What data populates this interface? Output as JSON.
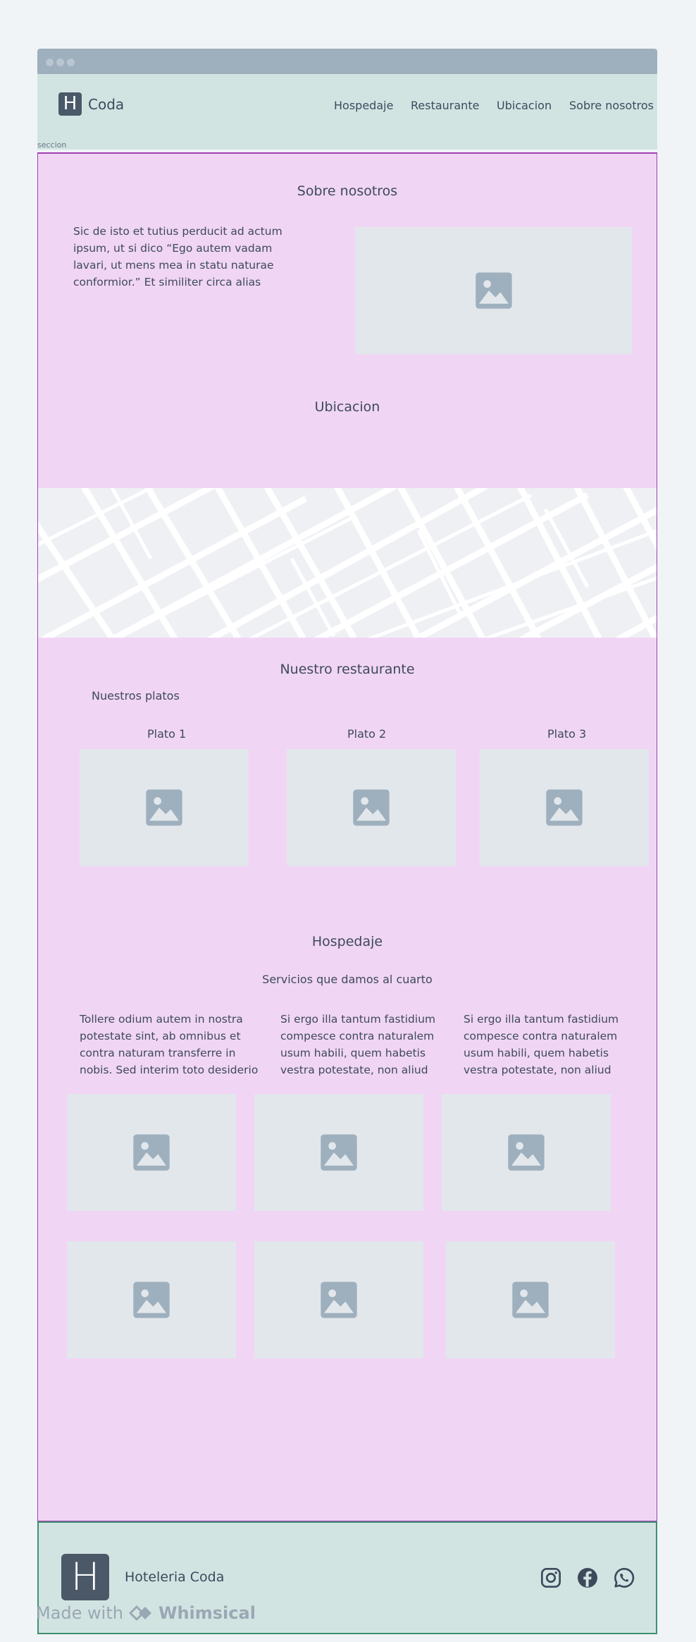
{
  "header": {
    "logo_letter": "H",
    "brand": "Coda",
    "nav": [
      "Hospedaje",
      "Restaurante",
      "Ubicacion",
      "Sobre nosotros"
    ]
  },
  "section_label": "seccion",
  "about": {
    "title": "Sobre nosotros",
    "text": "Sic de isto et tutius perducit ad actum ipsum, ut si dico “Ego autem vadam lavari, ut mens mea in statu naturae conformior.” Et similiter circa alias"
  },
  "location": {
    "title": "Ubicacion"
  },
  "restaurant": {
    "title": "Nuestro restaurante",
    "subtitle": "Nuestros platos",
    "dishes": [
      "Plato 1",
      "Plato 2",
      "Plato 3"
    ]
  },
  "lodging": {
    "title": "Hospedaje",
    "subtitle": "Servicios que damos al cuarto",
    "texts": [
      "Tollere odium autem in nostra potestate sint, ab omnibus et contra naturam transferre in nobis. Sed interim toto desiderio",
      "Si ergo illa tantum fastidium compesce contra naturalem usum habili, quem habetis vestra potestate, non aliud",
      "Si ergo illa tantum fastidium compesce contra naturalem usum habili, quem habetis vestra potestate, non aliud"
    ]
  },
  "footer": {
    "logo_letter": "H",
    "title": "Hoteleria Coda",
    "social_icons": [
      "instagram-icon",
      "facebook-icon",
      "whatsapp-icon"
    ]
  },
  "watermark": {
    "prefix": "Made with",
    "brand": "Whimsical"
  },
  "colors": {
    "header_bg": "#d2e4e2",
    "section_bg": "#f1d5f5",
    "section_border": "#a23fb4",
    "footer_border": "#3f8f70",
    "placeholder_bg": "#e2e7ec",
    "placeholder_icon": "#9eafbd",
    "text": "#3d4a5c"
  }
}
